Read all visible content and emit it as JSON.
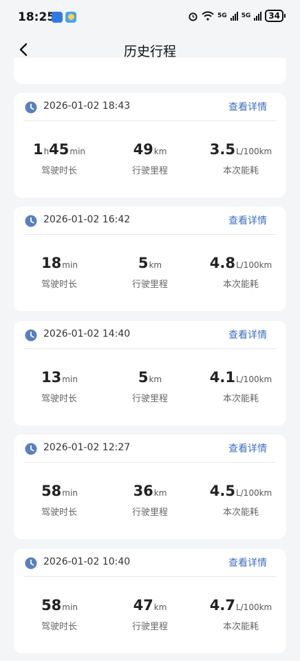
{
  "status_bar": {
    "time": "18:25",
    "battery": "34",
    "net1": "5G",
    "net2": "5G"
  },
  "header": {
    "title": "历史行程"
  },
  "labels": {
    "duration": "驾驶时长",
    "distance": "行驶里程",
    "consumption": "本次能耗",
    "detail_link": "查看详情"
  },
  "trips": [
    {
      "datetime": "2026-01-02 18:43",
      "hours": "1",
      "hours_unit": "h",
      "minutes": "45",
      "minutes_unit": "min",
      "distance": "49",
      "distance_unit": "km",
      "consumption": "3.5",
      "consumption_unit": "L/100km"
    },
    {
      "datetime": "2026-01-02 16:42",
      "hours": "",
      "hours_unit": "",
      "minutes": "18",
      "minutes_unit": "min",
      "distance": "5",
      "distance_unit": "km",
      "consumption": "4.8",
      "consumption_unit": "L/100km"
    },
    {
      "datetime": "2026-01-02 14:40",
      "hours": "",
      "hours_unit": "",
      "minutes": "13",
      "minutes_unit": "min",
      "distance": "5",
      "distance_unit": "km",
      "consumption": "4.1",
      "consumption_unit": "L/100km"
    },
    {
      "datetime": "2026-01-02 12:27",
      "hours": "",
      "hours_unit": "",
      "minutes": "58",
      "minutes_unit": "min",
      "distance": "36",
      "distance_unit": "km",
      "consumption": "4.5",
      "consumption_unit": "L/100km"
    },
    {
      "datetime": "2026-01-02 10:40",
      "hours": "",
      "hours_unit": "",
      "minutes": "58",
      "minutes_unit": "min",
      "distance": "47",
      "distance_unit": "km",
      "consumption": "4.7",
      "consumption_unit": "L/100km"
    }
  ],
  "colors": {
    "accent": "#3f6fbf",
    "clock_icon": "#5a7fbd",
    "background": "#f4f5f7"
  }
}
